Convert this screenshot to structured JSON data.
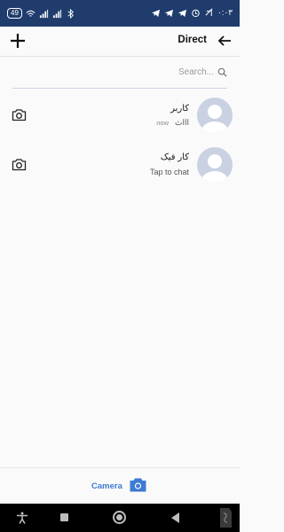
{
  "status_bar": {
    "battery": "49",
    "time": "۰:۰۳",
    "icons": [
      "wifi-icon",
      "signal-icon",
      "signal-icon",
      "bluetooth-icon",
      "volte-icon",
      "telegram-icon",
      "alarm-icon",
      "silent-icon"
    ]
  },
  "header": {
    "title": "Direct",
    "add_icon": "plus-icon",
    "back_icon": "arrow-left-icon"
  },
  "search": {
    "placeholder": "Search..."
  },
  "conversations": [
    {
      "name": "کاربر",
      "preview": "اااث",
      "time": "now",
      "avatar": "default-user-avatar",
      "action_icon": "camera-icon"
    },
    {
      "name": "کار فیک",
      "preview": "Tap to chat",
      "time": "",
      "avatar": "default-user-avatar",
      "action_icon": "camera-icon"
    }
  ],
  "bottom_bar": {
    "camera_label": "Camera",
    "camera_icon": "camera-icon"
  },
  "nav_bar": {
    "icons": [
      "accessibility-icon",
      "recents-icon",
      "home-icon",
      "back-icon",
      "app-watermark-icon"
    ]
  },
  "colors": {
    "status_bar": "#1f3c6d",
    "accent": "#3d7bd4",
    "avatar": "#c9d1e3",
    "background": "#fafafa"
  }
}
